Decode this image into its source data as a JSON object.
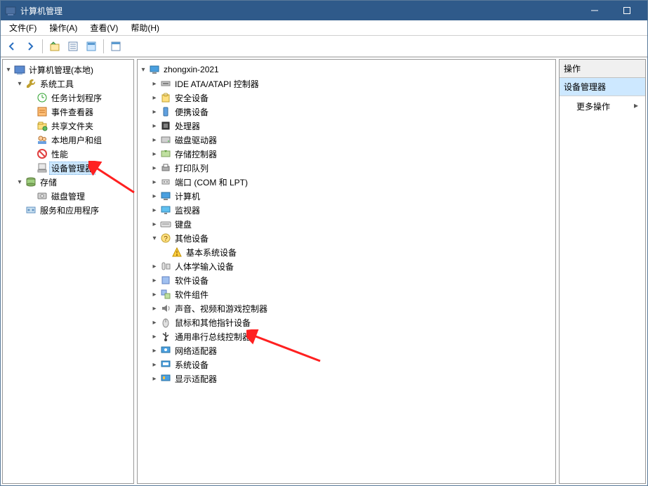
{
  "titlebar": {
    "title": "计算机管理"
  },
  "menubar": {
    "items": [
      "文件(F)",
      "操作(A)",
      "查看(V)",
      "帮助(H)"
    ]
  },
  "left_tree": {
    "root": "计算机管理(本地)",
    "nodes": [
      {
        "label": "系统工具",
        "expanded": true,
        "children": [
          {
            "label": "任务计划程序",
            "icon": "clock"
          },
          {
            "label": "事件查看器",
            "icon": "event"
          },
          {
            "label": "共享文件夹",
            "icon": "share"
          },
          {
            "label": "本地用户和组",
            "icon": "users"
          },
          {
            "label": "性能",
            "icon": "perf"
          },
          {
            "label": "设备管理器",
            "icon": "device",
            "selected": true
          }
        ]
      },
      {
        "label": "存储",
        "expanded": true,
        "icon": "storage",
        "children": [
          {
            "label": "磁盘管理",
            "icon": "disk",
            "leaf": true
          }
        ]
      },
      {
        "label": "服务和应用程序",
        "icon": "services"
      }
    ]
  },
  "device_tree": {
    "root": "zhongxin-2021",
    "items": [
      {
        "label": "IDE ATA/ATAPI 控制器",
        "icon": "ide"
      },
      {
        "label": "安全设备",
        "icon": "security"
      },
      {
        "label": "便携设备",
        "icon": "portable"
      },
      {
        "label": "处理器",
        "icon": "cpu"
      },
      {
        "label": "磁盘驱动器",
        "icon": "diskdrive"
      },
      {
        "label": "存储控制器",
        "icon": "storagectl"
      },
      {
        "label": "打印队列",
        "icon": "print"
      },
      {
        "label": "端口 (COM 和 LPT)",
        "icon": "port"
      },
      {
        "label": "计算机",
        "icon": "computer"
      },
      {
        "label": "监视器",
        "icon": "monitor"
      },
      {
        "label": "键盘",
        "icon": "keyboard"
      },
      {
        "label": "其他设备",
        "icon": "other",
        "expanded": true,
        "children": [
          {
            "label": "基本系统设备",
            "icon": "warn"
          }
        ]
      },
      {
        "label": "人体学输入设备",
        "icon": "hid"
      },
      {
        "label": "软件设备",
        "icon": "soft"
      },
      {
        "label": "软件组件",
        "icon": "softcomp"
      },
      {
        "label": "声音、视频和游戏控制器",
        "icon": "audio"
      },
      {
        "label": "鼠标和其他指针设备",
        "icon": "mouse"
      },
      {
        "label": "通用串行总线控制器",
        "icon": "usb"
      },
      {
        "label": "网络适配器",
        "icon": "net"
      },
      {
        "label": "系统设备",
        "icon": "sys"
      },
      {
        "label": "显示适配器",
        "icon": "display"
      }
    ]
  },
  "right_pane": {
    "header": "操作",
    "selected": "设备管理器",
    "more": "更多操作"
  }
}
